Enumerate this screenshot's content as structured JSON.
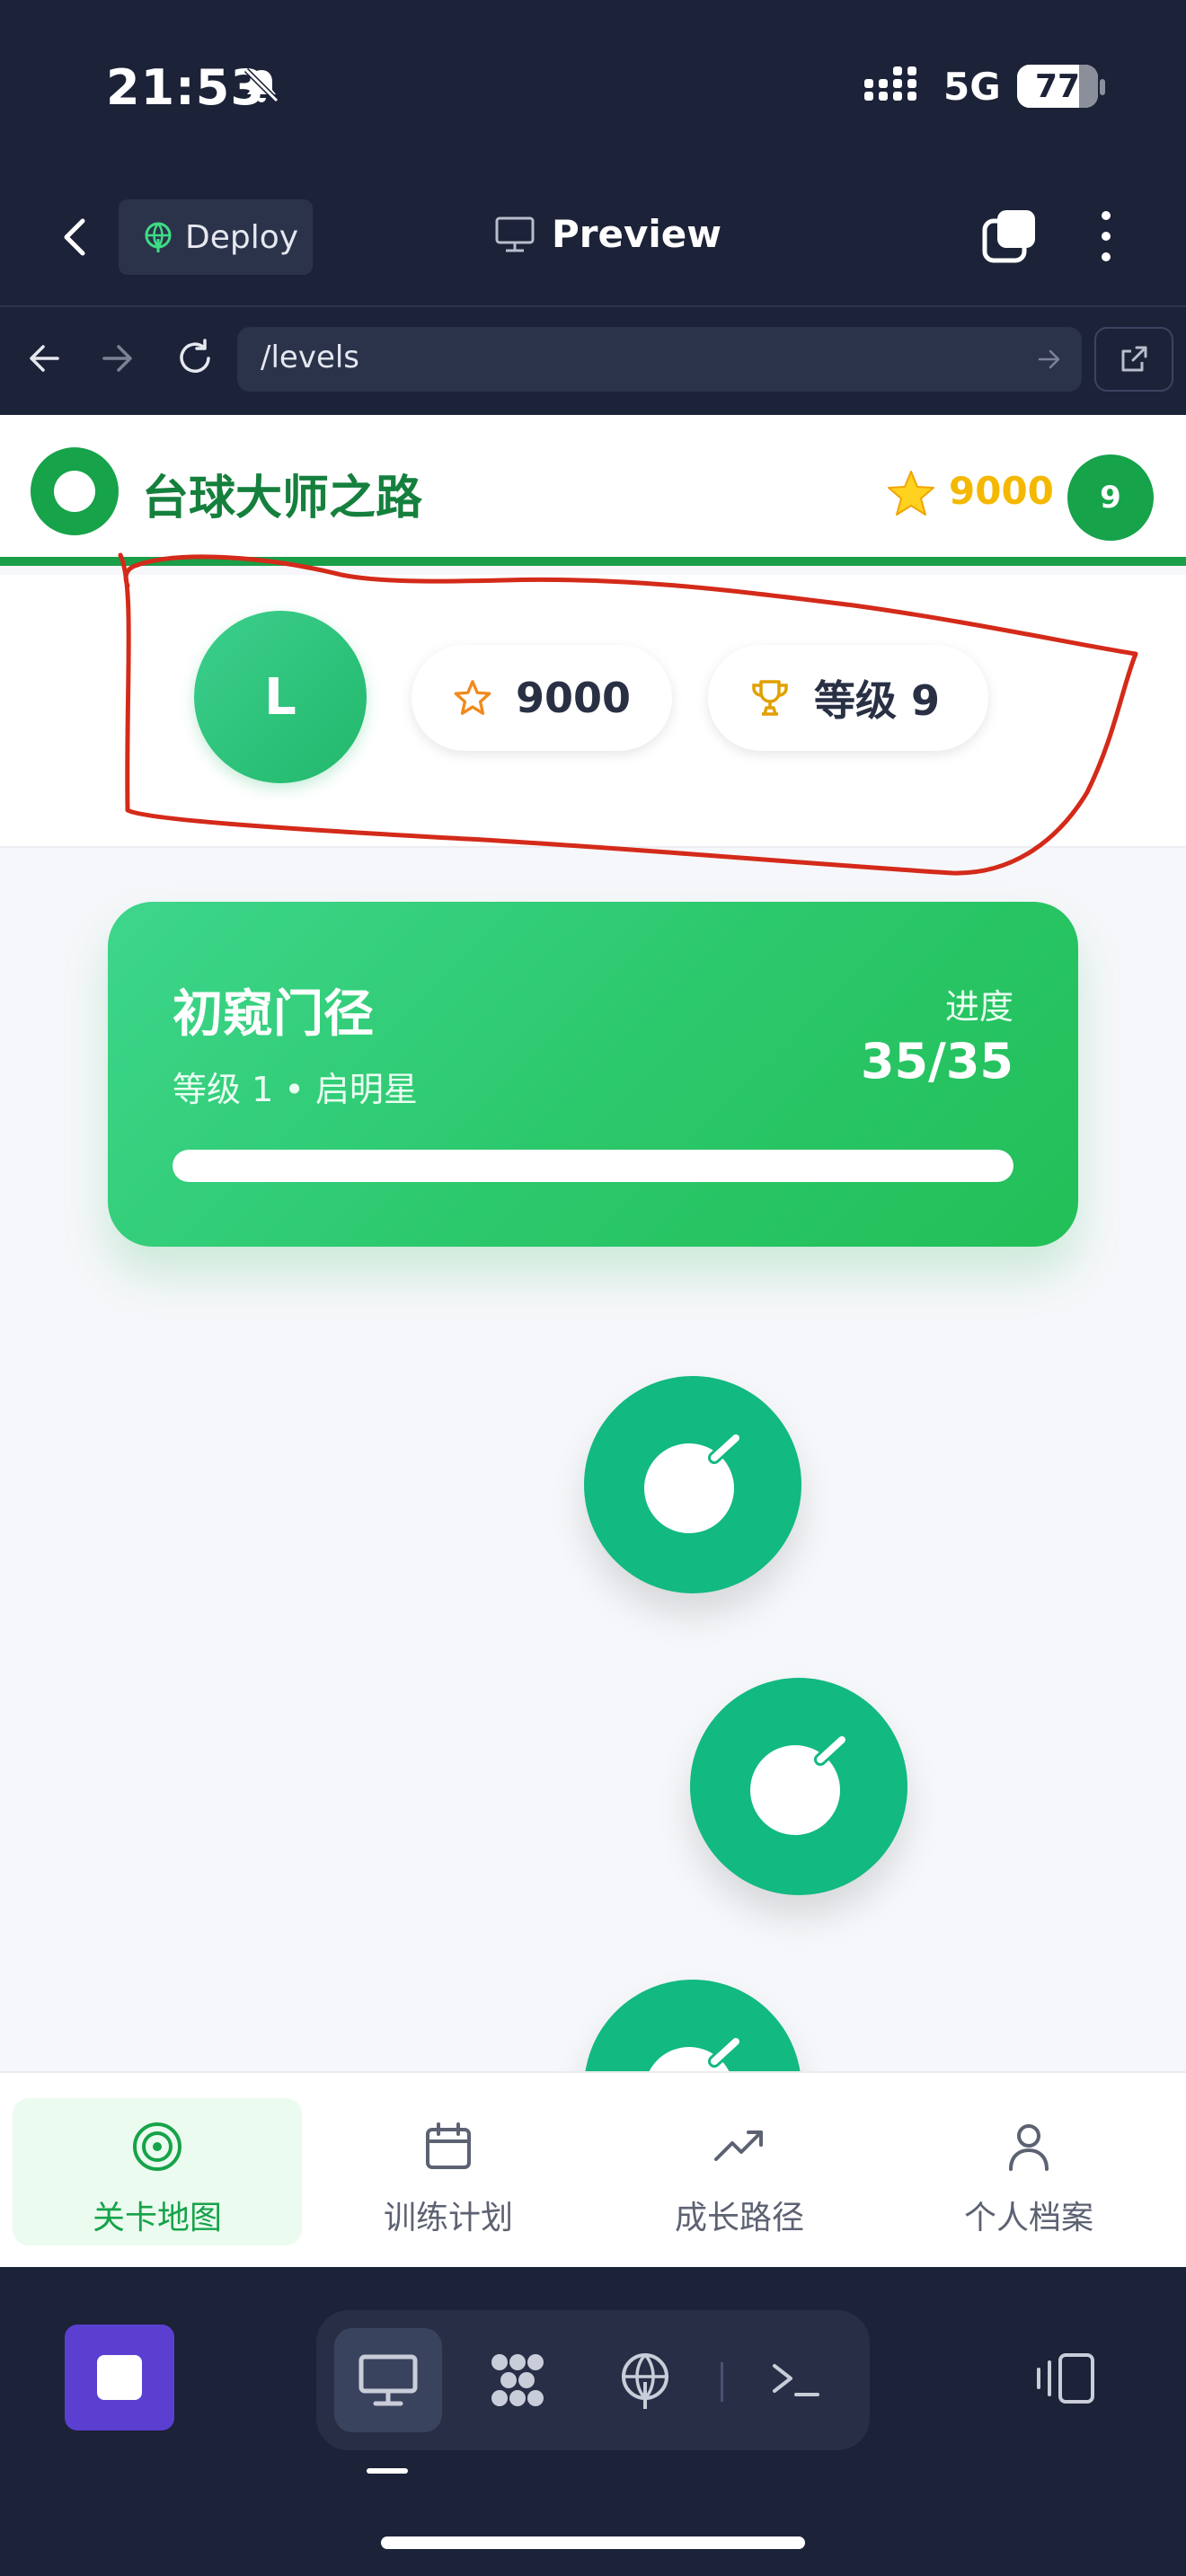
{
  "status_bar": {
    "time": "21:53",
    "network": "5G",
    "battery": "77",
    "battery_level": 0.77
  },
  "app_header": {
    "deploy_label": "Deploy",
    "title": "Preview"
  },
  "browser": {
    "url": "/levels"
  },
  "game": {
    "title": "台球大师之路",
    "points": "9000",
    "level_badge": "9",
    "user": {
      "avatar_letter": "L",
      "points": "9000",
      "level_label": "等级 9"
    },
    "level_card": {
      "title": "初窥门径",
      "subtitle": "等级 1 • 启明星",
      "progress_label": "进度",
      "progress_value": "35/35",
      "progress_fraction": 1.0
    }
  },
  "bottom_nav": [
    {
      "label": "关卡地图",
      "icon": "target-icon",
      "active": true
    },
    {
      "label": "训练计划",
      "icon": "calendar-icon",
      "active": false
    },
    {
      "label": "成长路径",
      "icon": "trending-up-icon",
      "active": false
    },
    {
      "label": "个人档案",
      "icon": "user-icon",
      "active": false
    }
  ],
  "colors": {
    "brand_green": "#16a34a",
    "gold": "#f5b800",
    "node_green": "#12b981",
    "annotation_red": "#d42a1a"
  }
}
